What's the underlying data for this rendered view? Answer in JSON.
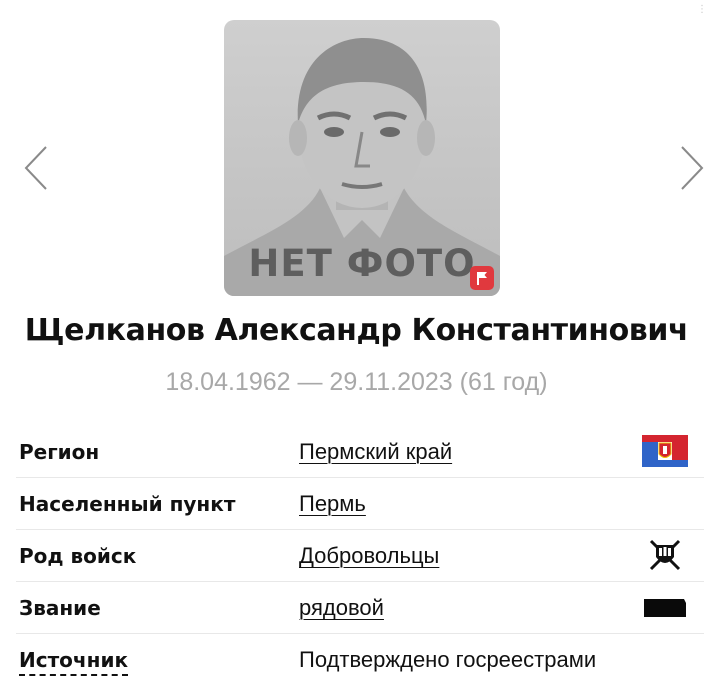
{
  "photo": {
    "no_photo_text": "НЕТ ФОТО",
    "badge_color": "#e0393e",
    "badge_icon": "flag-icon"
  },
  "person": {
    "full_name": "Щелканов Александр Константинович",
    "life_dates": "18.04.1962 — 29.11.2023 (61 год)"
  },
  "details": {
    "region": {
      "label": "Регион",
      "value": "Пермский край",
      "icon": "perm-krai-flag-icon"
    },
    "settlement": {
      "label": "Населенный пункт",
      "value": "Пермь"
    },
    "branch": {
      "label": "Род войск",
      "value": "Добровольцы",
      "icon": "volunteers-emblem-icon"
    },
    "rank": {
      "label": "Звание",
      "value": "рядовой",
      "icon": "rank-insignia-icon"
    },
    "source": {
      "label": "Источник",
      "value": "Подтверждено госреестрами"
    }
  },
  "colors": {
    "accent_red": "#e0393e",
    "text_primary": "#111111",
    "text_muted": "#a8a8a8",
    "flag_blue": "#2f64c8",
    "flag_red": "#d4252f"
  }
}
